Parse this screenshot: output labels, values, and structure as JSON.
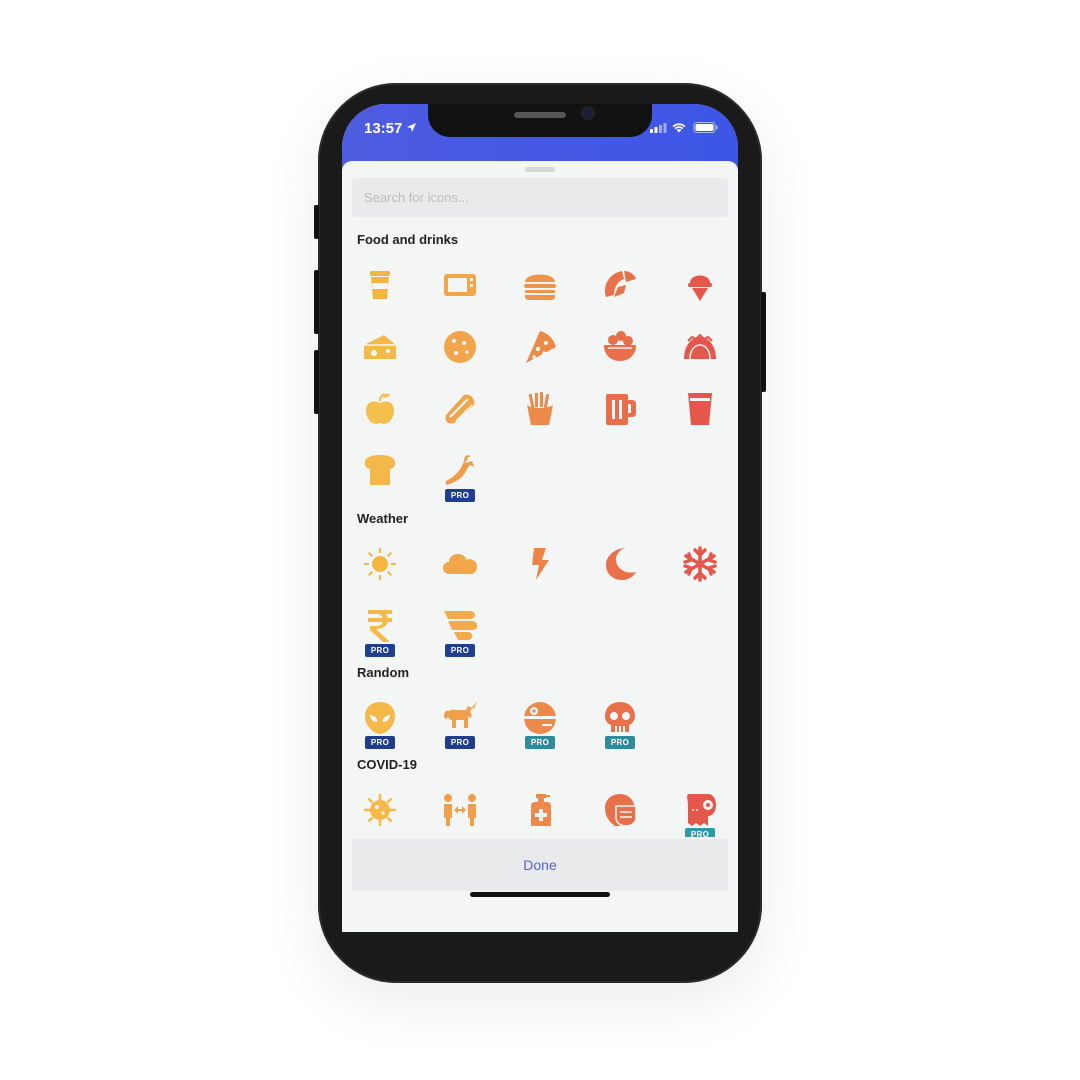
{
  "status": {
    "time": "13:57"
  },
  "search": {
    "placeholder": "Search for icons..."
  },
  "pro_label": "PRO",
  "colors": {
    "accent": "#4e5ce0",
    "pro_dark": "#1f3e8c",
    "pro_teal": "#2e8b9a"
  },
  "sections": [
    {
      "title": "Food and drinks",
      "icons": [
        {
          "name": "coffee-cup-icon",
          "color": "#f4b444",
          "pro": false
        },
        {
          "name": "microwave-icon",
          "color": "#f1a64a",
          "pro": false
        },
        {
          "name": "hamburger-icon",
          "color": "#ee954a",
          "pro": false
        },
        {
          "name": "croissant-icon",
          "color": "#e8734a",
          "pro": false
        },
        {
          "name": "ice-cream-icon",
          "color": "#e5574a",
          "pro": false
        },
        {
          "name": "cheese-icon",
          "color": "#f5b94a",
          "pro": false
        },
        {
          "name": "cookie-icon",
          "color": "#f2a54b",
          "pro": false
        },
        {
          "name": "pizza-slice-icon",
          "color": "#ec8a4a",
          "pro": false
        },
        {
          "name": "salad-bowl-icon",
          "color": "#e96e4a",
          "pro": false
        },
        {
          "name": "taco-icon",
          "color": "#e5554a",
          "pro": false
        },
        {
          "name": "apple-icon",
          "color": "#f5bf4d",
          "pro": false
        },
        {
          "name": "burrito-icon",
          "color": "#f0a54b",
          "pro": false
        },
        {
          "name": "french-fries-icon",
          "color": "#ec8a4a",
          "pro": false
        },
        {
          "name": "beer-mug-icon",
          "color": "#e86d4a",
          "pro": false
        },
        {
          "name": "glass-icon",
          "color": "#e5574a",
          "pro": false
        },
        {
          "name": "bread-icon",
          "color": "#f4b84a",
          "pro": false
        },
        {
          "name": "pepper-icon",
          "color": "#ef9c4a",
          "pro": true
        }
      ]
    },
    {
      "title": "Weather",
      "icons": [
        {
          "name": "sun-icon",
          "color": "#f5b53f",
          "pro": false
        },
        {
          "name": "cloud-icon",
          "color": "#f1a64a",
          "pro": false
        },
        {
          "name": "lightning-bolt-icon",
          "color": "#ec854a",
          "pro": false
        },
        {
          "name": "moon-icon",
          "color": "#e8714a",
          "pro": false
        },
        {
          "name": "snowflake-icon",
          "color": "#e5574a",
          "pro": false
        },
        {
          "name": "rupee-icon",
          "color": "#f5b94a",
          "pro": true
        },
        {
          "name": "wind-icon",
          "color": "#f2ab4b",
          "pro": true
        }
      ]
    },
    {
      "title": "Random",
      "icons": [
        {
          "name": "alien-icon",
          "color": "#f5b94a",
          "pro": true
        },
        {
          "name": "unicorn-icon",
          "color": "#f0a04a",
          "pro": true
        },
        {
          "name": "death-star-icon",
          "color": "#eb8a4a",
          "pro": true
        },
        {
          "name": "skull-icon",
          "color": "#e8714a",
          "pro": true
        }
      ]
    },
    {
      "title": "COVID-19",
      "icons": [
        {
          "name": "virus-icon",
          "color": "#f5b94a",
          "pro": false
        },
        {
          "name": "social-distance-icon",
          "color": "#f0a04a",
          "pro": false
        },
        {
          "name": "hand-sanitizer-icon",
          "color": "#eb8a4a",
          "pro": false
        },
        {
          "name": "face-mask-icon",
          "color": "#e8714a",
          "pro": false
        },
        {
          "name": "toilet-paper-icon",
          "color": "#e5574a",
          "pro": true
        }
      ]
    }
  ],
  "footer": {
    "done_label": "Done"
  }
}
